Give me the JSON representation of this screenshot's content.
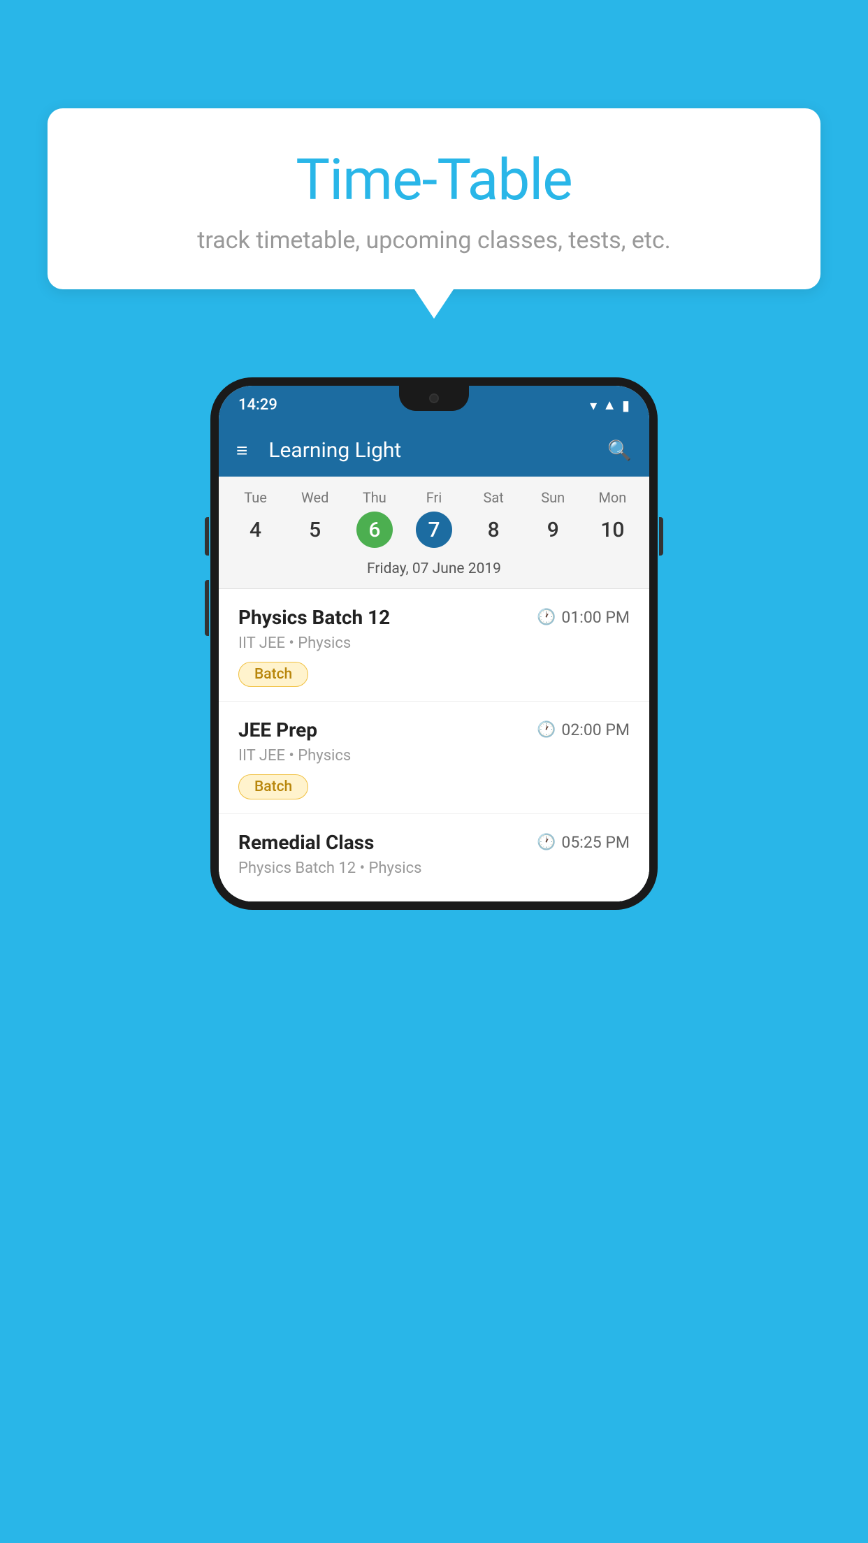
{
  "background_color": "#29B6E8",
  "bubble": {
    "title": "Time-Table",
    "subtitle": "track timetable, upcoming classes, tests, etc."
  },
  "phone": {
    "status_bar": {
      "time": "14:29"
    },
    "app_bar": {
      "title": "Learning Light"
    },
    "calendar": {
      "days": [
        {
          "label": "Tue",
          "num": "4",
          "state": "normal"
        },
        {
          "label": "Wed",
          "num": "5",
          "state": "normal"
        },
        {
          "label": "Thu",
          "num": "6",
          "state": "today"
        },
        {
          "label": "Fri",
          "num": "7",
          "state": "selected"
        },
        {
          "label": "Sat",
          "num": "8",
          "state": "normal"
        },
        {
          "label": "Sun",
          "num": "9",
          "state": "normal"
        },
        {
          "label": "Mon",
          "num": "10",
          "state": "normal"
        }
      ],
      "selected_date_label": "Friday, 07 June 2019"
    },
    "schedule": [
      {
        "title": "Physics Batch 12",
        "time": "01:00 PM",
        "subtitle": "IIT JEE • Physics",
        "tag": "Batch"
      },
      {
        "title": "JEE Prep",
        "time": "02:00 PM",
        "subtitle": "IIT JEE • Physics",
        "tag": "Batch"
      },
      {
        "title": "Remedial Class",
        "time": "05:25 PM",
        "subtitle": "Physics Batch 12 • Physics",
        "tag": null
      }
    ]
  }
}
